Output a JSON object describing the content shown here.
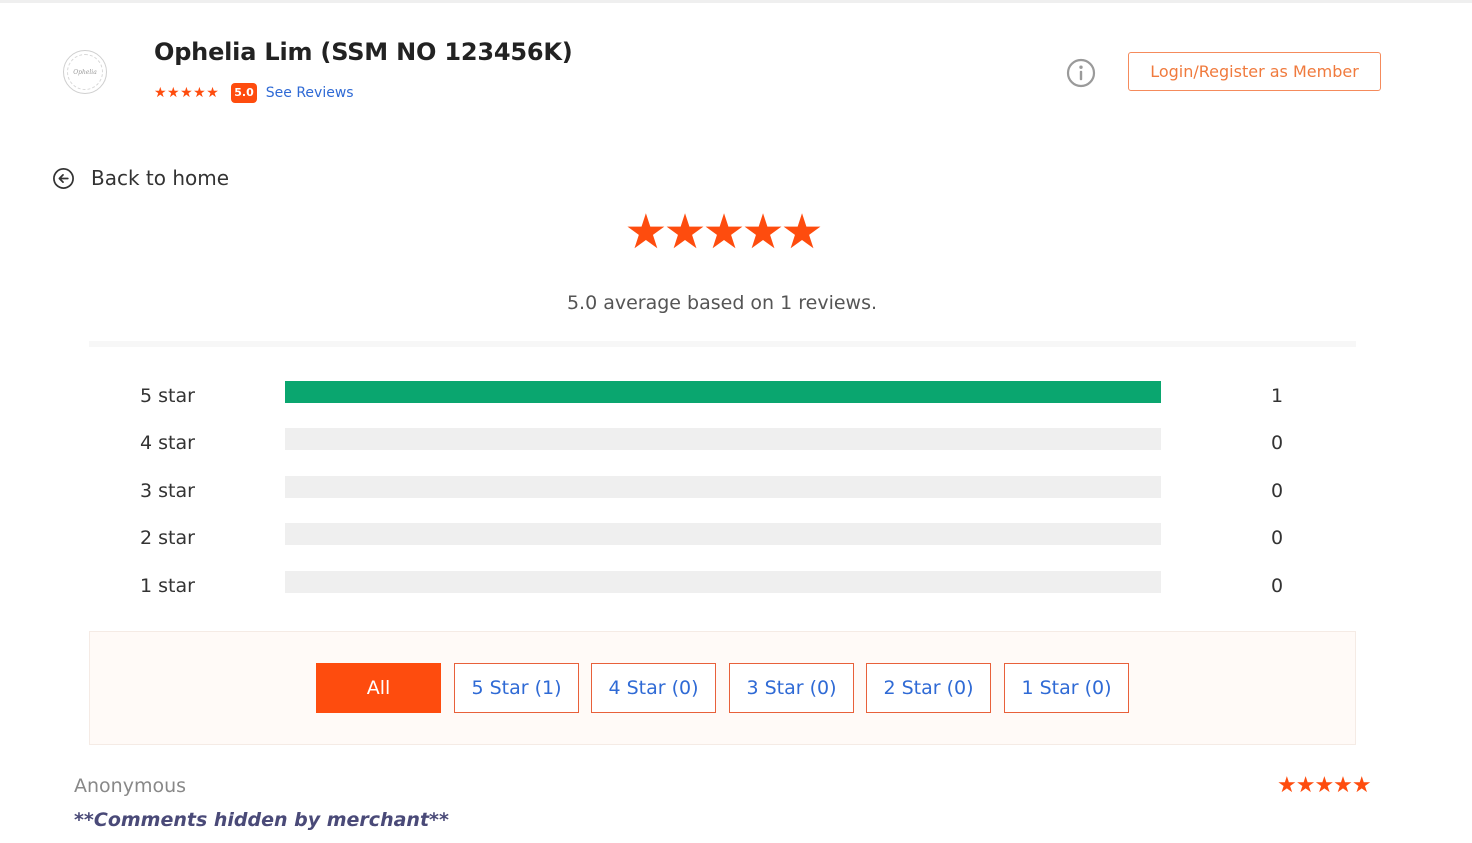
{
  "header": {
    "logo_text": "Ophelia",
    "merchant_name": "Ophelia Lim (SSM NO 123456K)",
    "stars": "★★★★★",
    "score": "5.0",
    "see_reviews": "See Reviews",
    "info_icon": "info-circle-icon",
    "login_label": "Login/Register as Member"
  },
  "nav": {
    "back_icon": "arrow-left-circle-icon",
    "back_label": "Back to home"
  },
  "summary": {
    "stars": "★★★★★",
    "average_text": "5.0 average based on 1 reviews.",
    "average": 5.0,
    "total_reviews": 1
  },
  "breakdown": [
    {
      "label": "5 star",
      "count": "1",
      "fraction": 1.0
    },
    {
      "label": "4 star",
      "count": "0",
      "fraction": 0
    },
    {
      "label": "3 star",
      "count": "0",
      "fraction": 0
    },
    {
      "label": "2 star",
      "count": "0",
      "fraction": 0
    },
    {
      "label": "1 star",
      "count": "0",
      "fraction": 0
    }
  ],
  "filters": [
    {
      "label": "All",
      "active": true
    },
    {
      "label": "5 Star (1)",
      "active": false
    },
    {
      "label": "4 Star (0)",
      "active": false
    },
    {
      "label": "3 Star (0)",
      "active": false
    },
    {
      "label": "2 Star (0)",
      "active": false
    },
    {
      "label": "1 Star (0)",
      "active": false
    }
  ],
  "reviews": [
    {
      "author": "Anonymous",
      "stars": "★★★★★",
      "rating": 5,
      "comment": "**Comments hidden by merchant**"
    }
  ],
  "colors": {
    "accent": "#fe4c0e",
    "bar_fill": "#0aa66f",
    "bar_track": "#efefef",
    "link": "#2f6ad5",
    "login_border": "#f58b5c"
  }
}
